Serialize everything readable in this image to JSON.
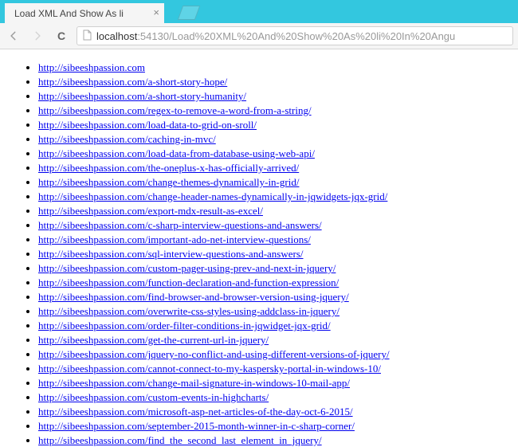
{
  "browser": {
    "tab_title": "Load XML And Show As li",
    "url_display_host": "localhost",
    "url_display_rest": ":54130/Load%20XML%20And%20Show%20As%20li%20In%20Angu"
  },
  "links": [
    "http://sibeeshpassion.com",
    "http://sibeeshpassion.com/a-short-story-hope/",
    "http://sibeeshpassion.com/a-short-story-humanity/",
    "http://sibeeshpassion.com/regex-to-remove-a-word-from-a-string/",
    "http://sibeeshpassion.com/load-data-to-grid-on-sroll/",
    "http://sibeeshpassion.com/caching-in-mvc/",
    "http://sibeeshpassion.com/load-data-from-database-using-web-api/",
    "http://sibeeshpassion.com/the-oneplus-x-has-officially-arrived/",
    "http://sibeeshpassion.com/change-themes-dynamically-in-grid/",
    "http://sibeeshpassion.com/change-header-names-dynamically-in-jqwidgets-jqx-grid/",
    "http://sibeeshpassion.com/export-mdx-result-as-excel/",
    "http://sibeeshpassion.com/c-sharp-interview-questions-and-answers/",
    "http://sibeeshpassion.com/important-ado-net-interview-questions/",
    "http://sibeeshpassion.com/sql-interview-questions-and-answers/",
    "http://sibeeshpassion.com/custom-pager-using-prev-and-next-in-jquery/",
    "http://sibeeshpassion.com/function-declaration-and-function-expression/",
    "http://sibeeshpassion.com/find-browser-and-browser-version-using-jquery/",
    "http://sibeeshpassion.com/overwrite-css-styles-using-addclass-in-jquery/",
    "http://sibeeshpassion.com/order-filter-conditions-in-jqwidget-jqx-grid/",
    "http://sibeeshpassion.com/get-the-current-url-in-jquery/",
    "http://sibeeshpassion.com/jquery-no-conflict-and-using-different-versions-of-jquery/",
    "http://sibeeshpassion.com/cannot-connect-to-my-kaspersky-portal-in-windows-10/",
    "http://sibeeshpassion.com/change-mail-signature-in-windows-10-mail-app/",
    "http://sibeeshpassion.com/custom-events-in-highcharts/",
    "http://sibeeshpassion.com/microsoft-asp-net-articles-of-the-day-oct-6-2015/",
    "http://sibeeshpassion.com/september-2015-month-winner-in-c-sharp-corner/",
    "http://sibeeshpassion.com/find_the_second_last_element_in_jquery/"
  ]
}
